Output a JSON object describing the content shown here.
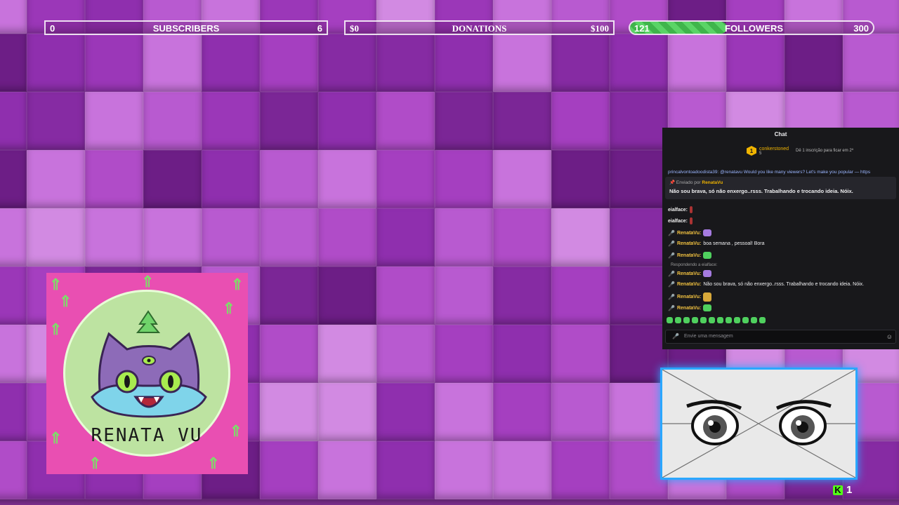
{
  "goals": {
    "subscribers": {
      "current": "0",
      "label": "SUBSCRIBERS",
      "target": "6"
    },
    "donations": {
      "current": "$0",
      "label": "DONATIONS",
      "target": "$100"
    },
    "followers": {
      "current": "121",
      "label": "FOLLOWERS",
      "target": "300",
      "progress": 0.4
    }
  },
  "logo": {
    "name": "RENATA VU"
  },
  "chat": {
    "title": "Chat",
    "top_gifter": {
      "rank": "1",
      "user": "conkerstoned",
      "count": "5",
      "hint": "Dê 1 inscrição para ficar em 2º"
    },
    "cut_line": "princalvontoadoodista39: @renatavu Would you like many viewers? Let's make you popular — https",
    "pinned": {
      "sent_by": "Enviado por",
      "author": "RenataVu",
      "text": "Não sou brava, só não enxergo..rsss. Trabalhando e trocando ideia. Nóix."
    },
    "messages": [
      {
        "user": "eialface:",
        "text": ""
      },
      {
        "user": "eialface:",
        "text": ""
      },
      {
        "user": "RenataVu:",
        "text": ""
      },
      {
        "user": "RenataVu:",
        "text": "boa semana , pessoal! Bora"
      },
      {
        "user": "RenataVu:",
        "text": ""
      },
      {
        "user": "RenataVu:",
        "text": ""
      },
      {
        "user": "RenataVu:",
        "text": "Não sou brava, só não enxergo..rsss. Trabalhando e trocando ideia. Nóix."
      },
      {
        "user": "RenataVu:",
        "text": ""
      },
      {
        "user": "RenataVu:",
        "text": ""
      }
    ],
    "reply_label": "Respondendo a eialface:",
    "input_placeholder": "Envie uma mensagem"
  },
  "kick": {
    "count": "1"
  },
  "colors": {
    "accent_green": "#53fc18",
    "cam_border": "#2aa7ff",
    "logo_pink": "#e94fb2"
  }
}
